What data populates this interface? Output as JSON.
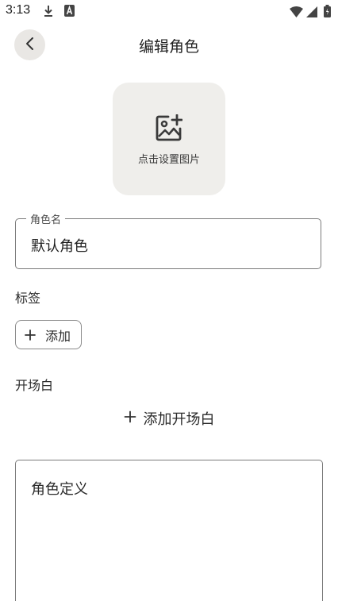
{
  "status_bar": {
    "time": "3:13",
    "icons": [
      "download-icon",
      "a-badge-icon",
      "wifi-icon",
      "signal-icon",
      "battery-icon"
    ]
  },
  "header": {
    "back_icon": "back-arrow-icon",
    "title": "编辑角色"
  },
  "image_picker": {
    "icon": "add-image-icon",
    "label": "点击设置图片"
  },
  "name_field": {
    "label": "角色名",
    "value": "默认角色"
  },
  "tags": {
    "label": "标签",
    "add_label": "添加"
  },
  "opening": {
    "label": "开场白",
    "add_label": "添加开场白"
  },
  "definition": {
    "placeholder": "角色定义"
  },
  "colors": {
    "back_button_bg": "#e9e7e4",
    "image_picker_bg": "#efeeeb",
    "border": "#7a7a7a",
    "text": "#1f1f1f"
  }
}
